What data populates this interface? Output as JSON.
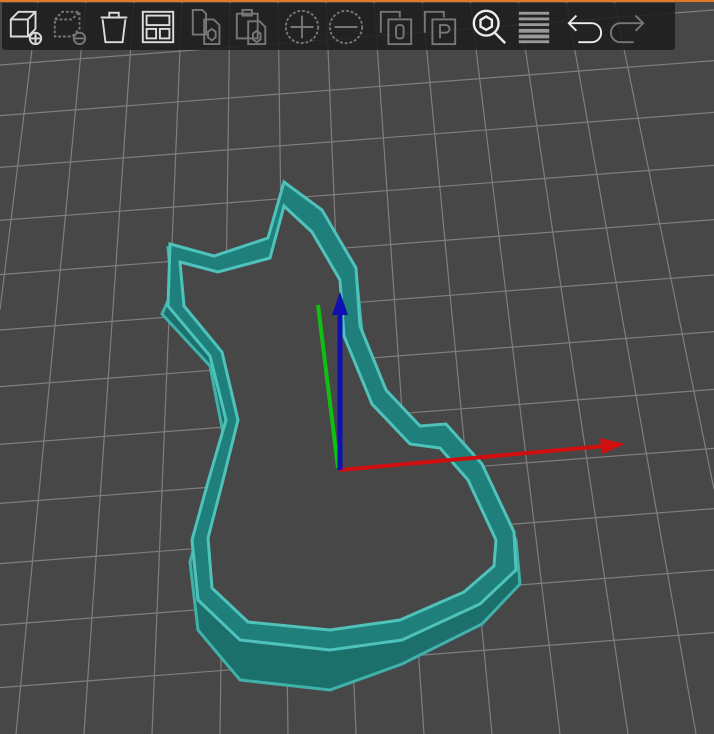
{
  "colors": {
    "accent": "#e0782a",
    "background": "#474747",
    "grid": "#8a8a8a",
    "model_wall": "#1f7c78",
    "model_rim": "#3fb1ab",
    "axis_x": "#d01010",
    "axis_y": "#10c010",
    "axis_z": "#1010b0"
  },
  "toolbar": {
    "items": [
      {
        "icon": "add-object-icon",
        "enabled": true
      },
      {
        "icon": "delete-object-icon",
        "enabled": false
      },
      {
        "icon": "delete-all-icon",
        "enabled": true
      },
      {
        "icon": "arrange-icon",
        "enabled": true
      },
      {
        "icon": "copy-icon",
        "enabled": false
      },
      {
        "icon": "paste-icon",
        "enabled": false
      },
      {
        "icon": "add-instance-icon",
        "enabled": false
      },
      {
        "icon": "remove-instance-icon",
        "enabled": false
      },
      {
        "icon": "split-objects-icon",
        "enabled": false
      },
      {
        "icon": "split-parts-icon",
        "enabled": false
      },
      {
        "icon": "search-icon",
        "enabled": true
      },
      {
        "icon": "layers-editing-icon",
        "enabled": true
      },
      {
        "icon": "undo-icon",
        "enabled": true
      },
      {
        "icon": "redo-icon",
        "enabled": false
      }
    ]
  }
}
